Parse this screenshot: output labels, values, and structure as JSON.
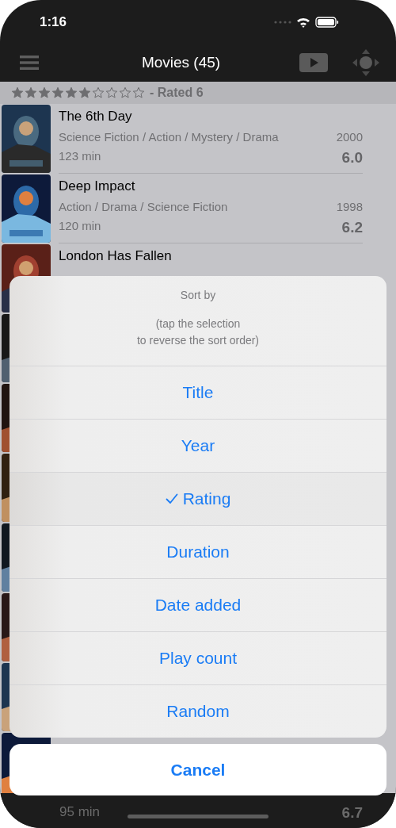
{
  "status_bar": {
    "time": "1:16"
  },
  "nav": {
    "title": "Movies (45)"
  },
  "section": {
    "stars": 6,
    "label": "- Rated 6"
  },
  "movies": [
    {
      "title": "The 6th Day",
      "genres": "Science Fiction / Action / Mystery / Drama",
      "year": "2000",
      "duration": "123 min",
      "rating": "6.0"
    },
    {
      "title": "Deep Impact",
      "genres": "Action / Drama / Science Fiction",
      "year": "1998",
      "duration": "120 min",
      "rating": "6.2"
    },
    {
      "title": "London Has Fallen"
    }
  ],
  "bottom_row": {
    "duration": "95 min",
    "rating": "6.7"
  },
  "sort_sheet": {
    "title": "Sort by",
    "hint": "(tap the selection\nto reverse the sort order)",
    "options": [
      {
        "label": "Title",
        "selected": false
      },
      {
        "label": "Year",
        "selected": false
      },
      {
        "label": "Rating",
        "selected": true
      },
      {
        "label": "Duration",
        "selected": false
      },
      {
        "label": "Date added",
        "selected": false
      },
      {
        "label": "Play count",
        "selected": false
      },
      {
        "label": "Random",
        "selected": false
      }
    ],
    "cancel": "Cancel"
  }
}
